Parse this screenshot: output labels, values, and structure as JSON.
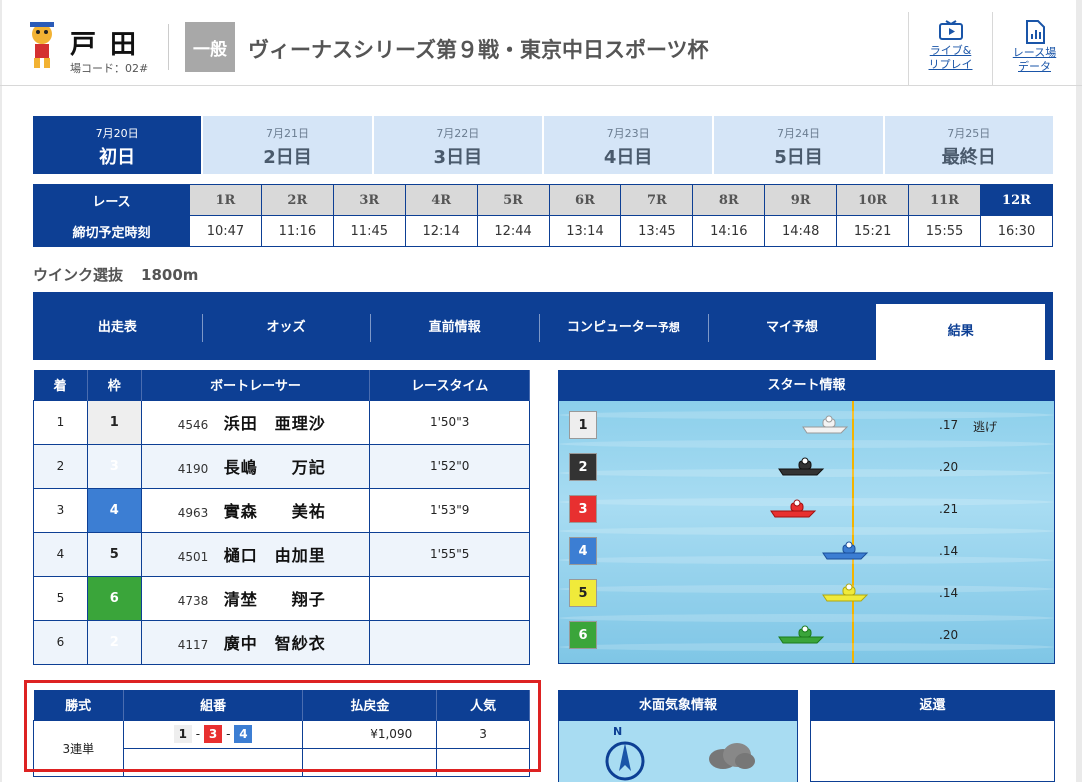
{
  "header": {
    "venue_name": "戸田",
    "venue_code": "場コード：02#",
    "grade": "一般",
    "race_title": "ヴィーナスシリーズ第９戦・東京中日スポーツ杯",
    "live_label_1": "ライブ&",
    "live_label_2": "リプレイ",
    "data_label_1": "レース場",
    "data_label_2": "データ"
  },
  "days": [
    {
      "date": "7月20日",
      "label": "初日",
      "active": true
    },
    {
      "date": "7月21日",
      "label": "2日目",
      "active": false
    },
    {
      "date": "7月22日",
      "label": "3日目",
      "active": false
    },
    {
      "date": "7月23日",
      "label": "4日目",
      "active": false
    },
    {
      "date": "7月24日",
      "label": "5日目",
      "active": false
    },
    {
      "date": "7月25日",
      "label": "最終日",
      "active": false
    }
  ],
  "race_table": {
    "race_header": "レース",
    "time_header": "締切予定時刻",
    "races": [
      "1R",
      "2R",
      "3R",
      "4R",
      "5R",
      "6R",
      "7R",
      "8R",
      "9R",
      "10R",
      "11R",
      "12R"
    ],
    "times": [
      "10:47",
      "11:16",
      "11:45",
      "12:14",
      "12:44",
      "13:14",
      "13:45",
      "14:16",
      "14:48",
      "15:21",
      "15:55",
      "16:30"
    ],
    "active_index": 11
  },
  "race_name": "ウインク選抜",
  "race_distance": "1800m",
  "section_tabs": [
    "出走表",
    "オッズ",
    "直前情報",
    "コンピューター|予想",
    "マイ予想",
    "結果"
  ],
  "section_active": 5,
  "results": {
    "headers": [
      "着",
      "枠",
      "ボートレーサー",
      "レースタイム"
    ],
    "rows": [
      {
        "place": "1",
        "waku": "1",
        "id": "4546",
        "name": "浜田　亜理沙",
        "time": "1'50\"3"
      },
      {
        "place": "2",
        "waku": "3",
        "id": "4190",
        "name": "長嶋　　万記",
        "time": "1'52\"0"
      },
      {
        "place": "3",
        "waku": "4",
        "id": "4963",
        "name": "實森　　美祐",
        "time": "1'53\"9"
      },
      {
        "place": "4",
        "waku": "5",
        "id": "4501",
        "name": "樋口　由加里",
        "time": "1'55\"5"
      },
      {
        "place": "5",
        "waku": "6",
        "id": "4738",
        "name": "清埜　　翔子",
        "time": ""
      },
      {
        "place": "6",
        "waku": "2",
        "id": "4117",
        "name": "廣中　智紗衣",
        "time": ""
      }
    ]
  },
  "start_info": {
    "title": "スタート情報",
    "rows": [
      {
        "num": "1",
        "st": ".17",
        "kimarite": "逃げ",
        "offset": 0.58
      },
      {
        "num": "2",
        "st": ".20",
        "kimarite": "",
        "offset": 0.52
      },
      {
        "num": "3",
        "st": ".21",
        "kimarite": "",
        "offset": 0.5
      },
      {
        "num": "4",
        "st": ".14",
        "kimarite": "",
        "offset": 0.63
      },
      {
        "num": "5",
        "st": ".14",
        "kimarite": "",
        "offset": 0.63
      },
      {
        "num": "6",
        "st": ".20",
        "kimarite": "",
        "offset": 0.52
      }
    ]
  },
  "payout": {
    "headers": [
      "勝式",
      "組番",
      "払戻金",
      "人気"
    ],
    "type": "3連単",
    "combo": [
      "1",
      "3",
      "4"
    ],
    "amount": "¥1,090",
    "popularity": "3"
  },
  "weather_title": "水面気象情報",
  "refund_title": "返還",
  "colors": {
    "navy": "#0d3f94",
    "highlight": "#dd2222"
  }
}
